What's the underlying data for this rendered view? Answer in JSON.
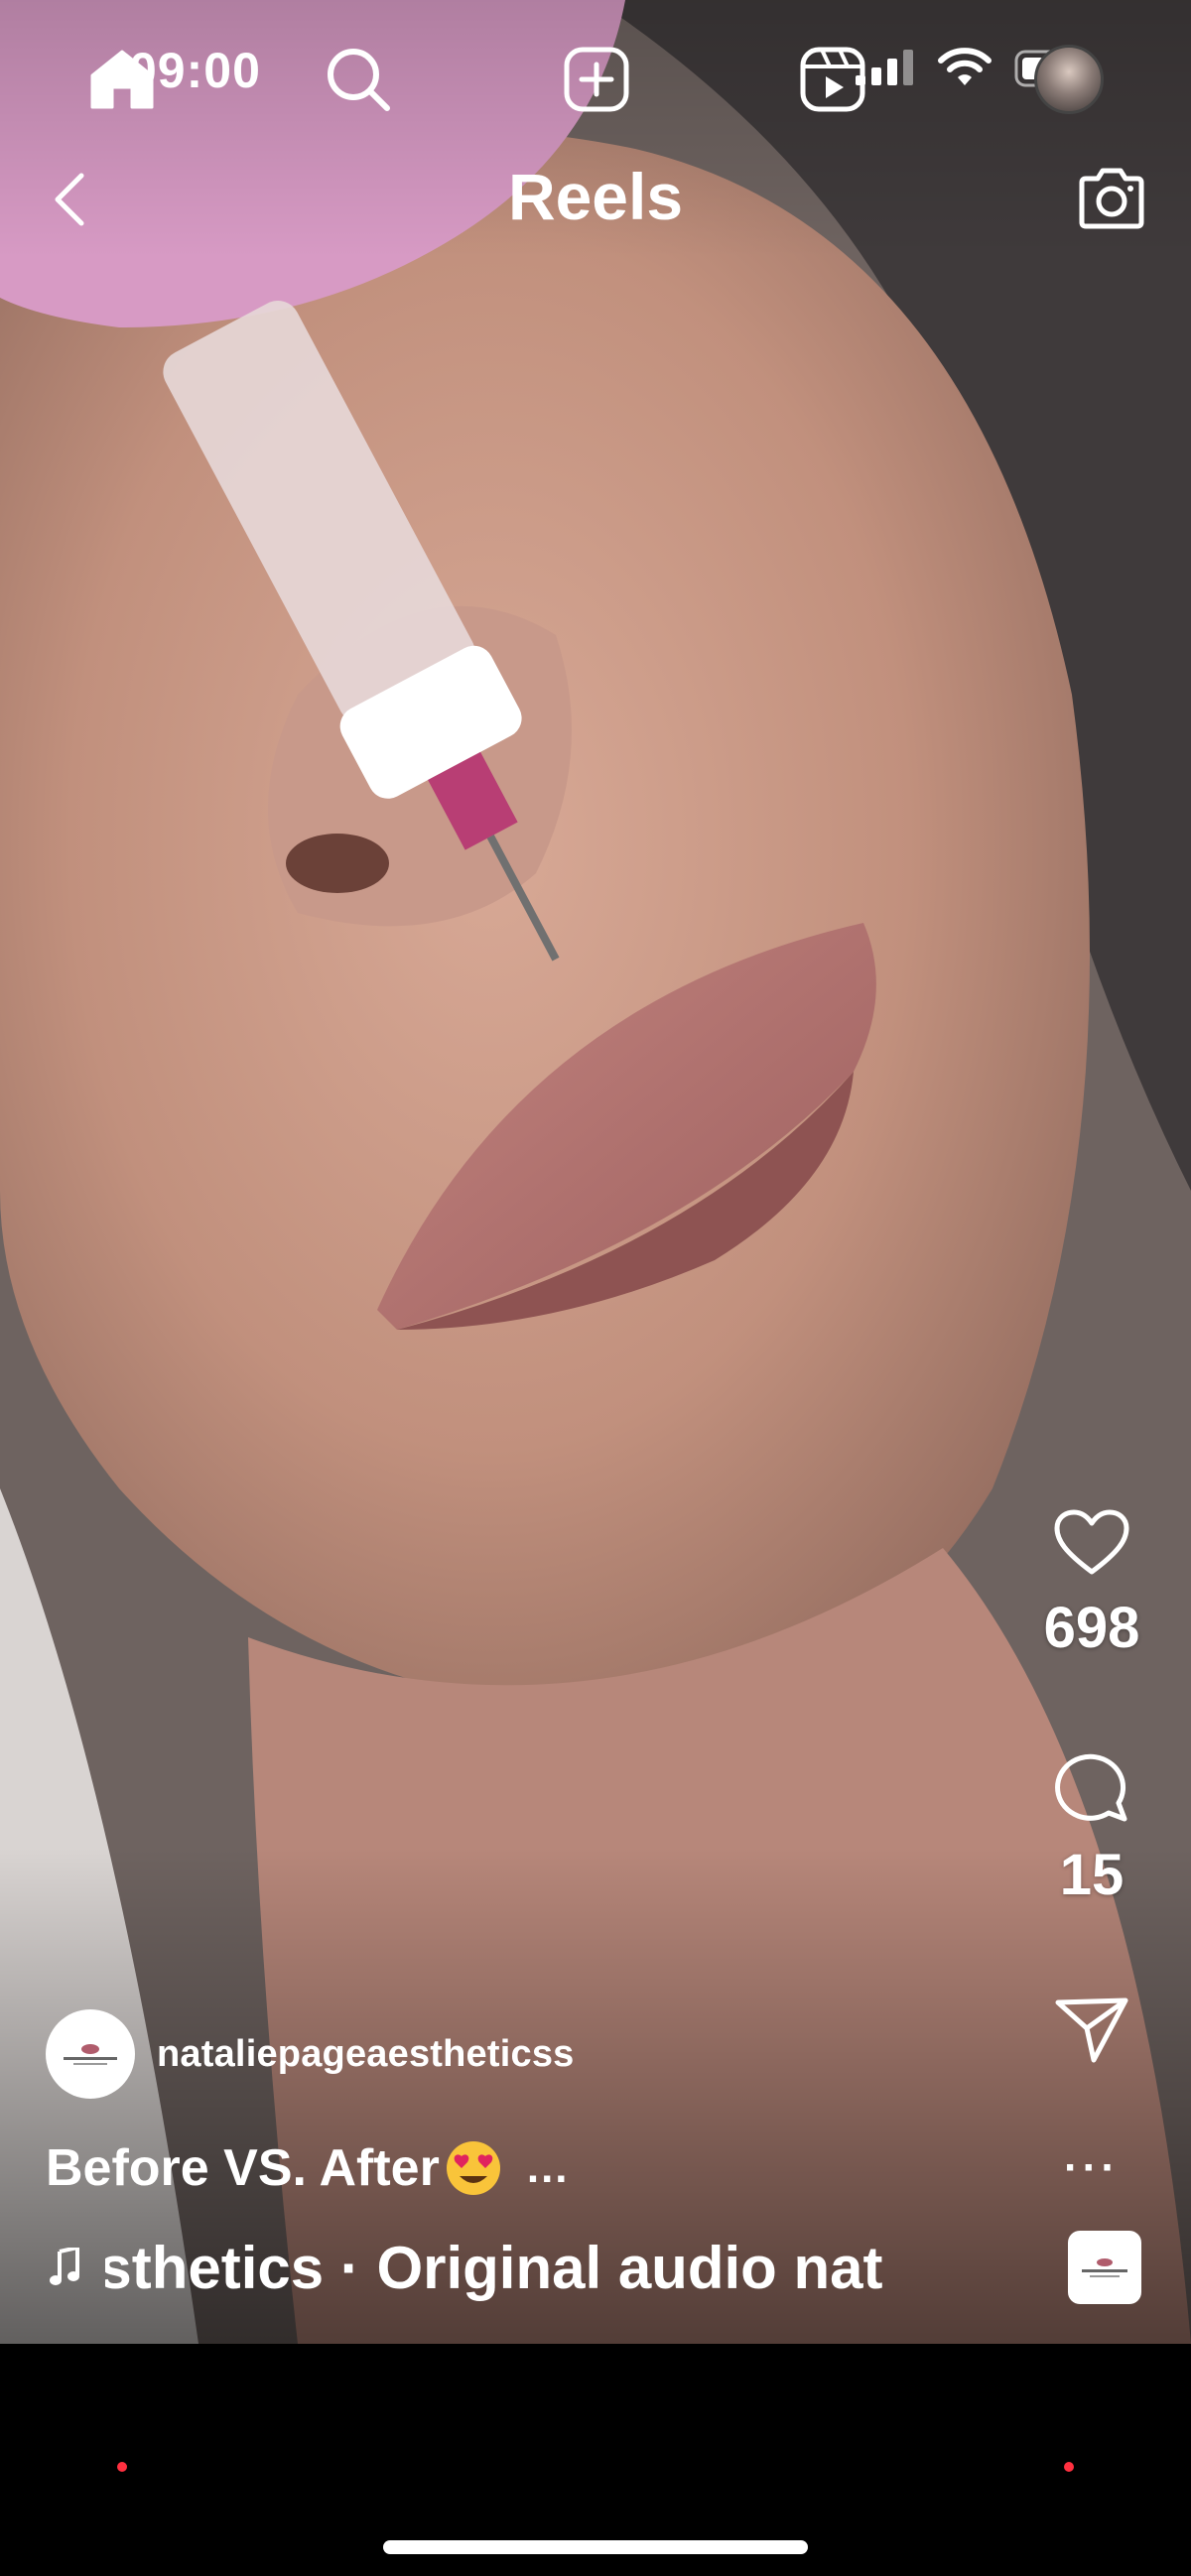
{
  "status_bar": {
    "time": "09:00"
  },
  "header": {
    "title": "Reels"
  },
  "actions": {
    "likes": "698",
    "comments": "15",
    "more": "···"
  },
  "post": {
    "author": "nataliepageaestheticss",
    "caption": "Before VS. After",
    "caption_more": "...",
    "audio": "esthetics · Original audio   nat"
  },
  "icons": {
    "back": "chevron-left-icon",
    "camera": "camera-icon",
    "like": "heart-icon",
    "comment": "comment-bubble-icon",
    "share": "paper-plane-icon",
    "music": "music-note-icon",
    "home": "home-icon",
    "search": "search-icon",
    "create": "plus-square-icon",
    "reels": "reels-icon"
  },
  "colors": {
    "notification_dot": "#ff3040",
    "tab_bar": "#000000"
  }
}
